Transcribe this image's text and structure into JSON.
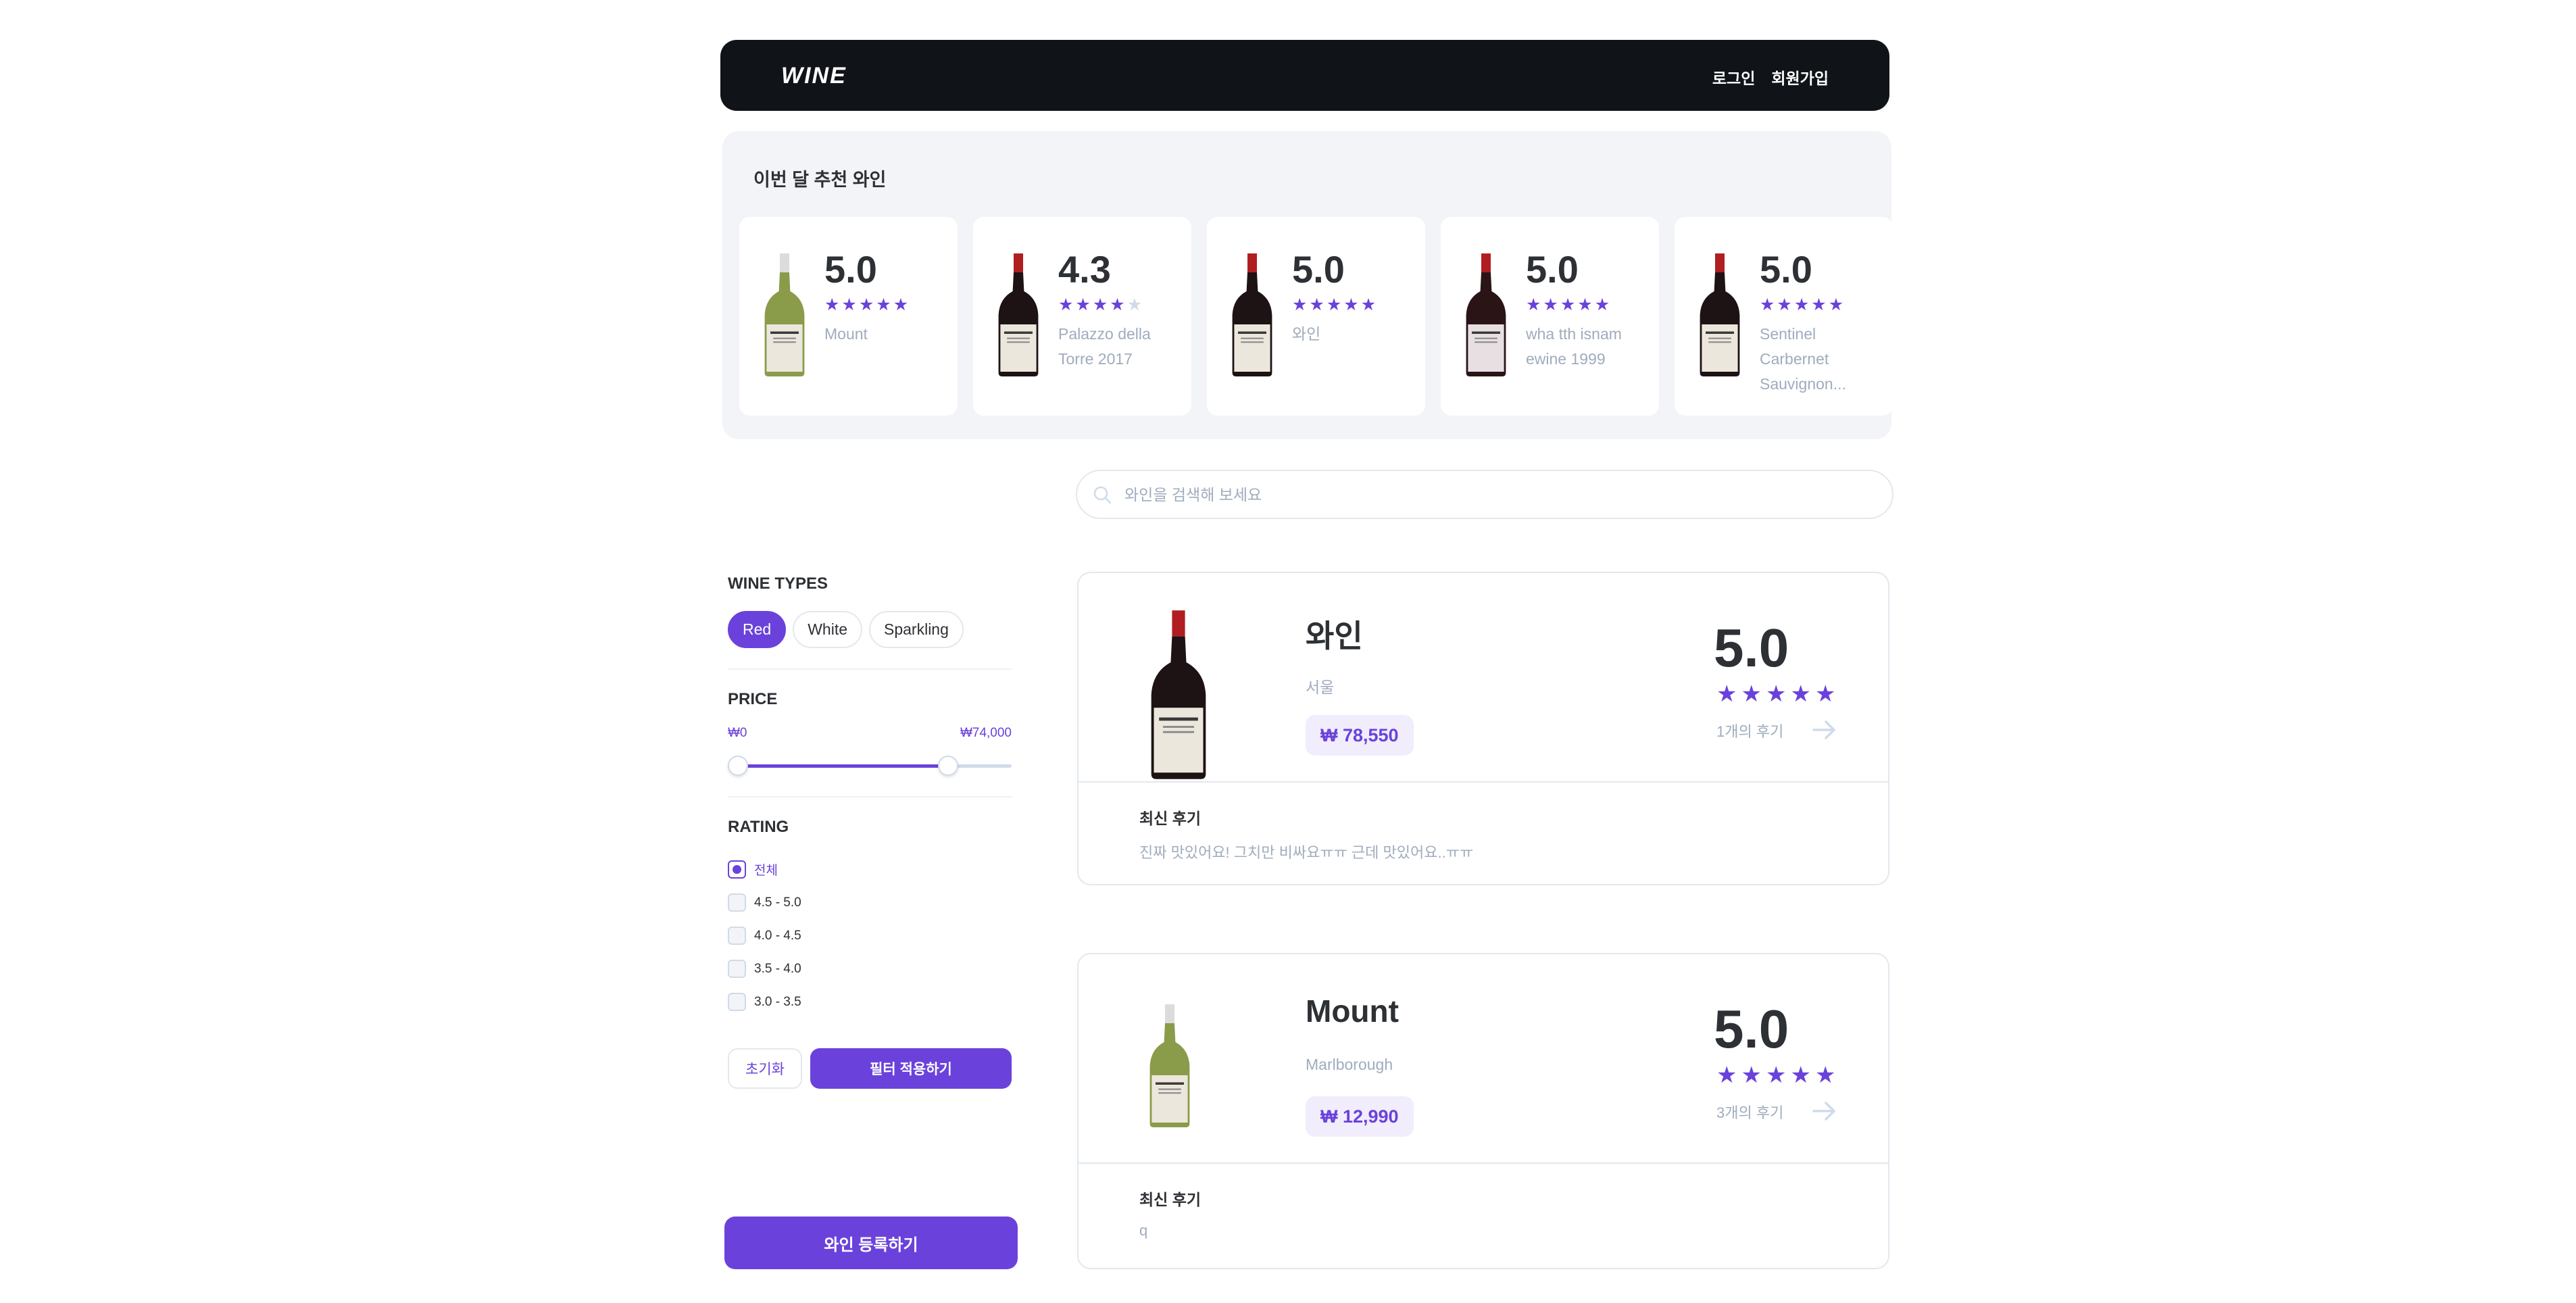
{
  "header": {
    "logo": "WINE",
    "login": "로그인",
    "signup": "회원가입"
  },
  "recommended": {
    "title": "이번 달 추천 와인",
    "items": [
      {
        "score": "5.0",
        "rating": 5,
        "name": "Mount",
        "bottle": "white"
      },
      {
        "score": "4.3",
        "rating": 4,
        "name": "Palazzo della Torre 2017",
        "bottle": "red-label"
      },
      {
        "score": "5.0",
        "rating": 5,
        "name": "와인",
        "bottle": "red-label"
      },
      {
        "score": "5.0",
        "rating": 5,
        "name": "wha tth isnam ewine 1999",
        "bottle": "dark"
      },
      {
        "score": "5.0",
        "rating": 5,
        "name": "Sentinel Carbernet Sauvignon...",
        "bottle": "red-label"
      }
    ]
  },
  "search": {
    "placeholder": "와인을 검색해 보세요",
    "icon": "search-icon"
  },
  "filter": {
    "types_title": "WINE TYPES",
    "types": [
      {
        "label": "Red",
        "active": true
      },
      {
        "label": "White",
        "active": false
      },
      {
        "label": "Sparkling",
        "active": false
      }
    ],
    "price_title": "PRICE",
    "price_min": "₩0",
    "price_max": "₩74,000",
    "price_low_fraction": 0.0,
    "price_high_fraction": 0.74,
    "rating_title": "RATING",
    "rating_options": [
      {
        "label": "전체",
        "checked": true
      },
      {
        "label": "4.5 - 5.0",
        "checked": false
      },
      {
        "label": "4.0 - 4.5",
        "checked": false
      },
      {
        "label": "3.5 - 4.0",
        "checked": false
      },
      {
        "label": "3.0 - 3.5",
        "checked": false
      }
    ],
    "reset_label": "초기화",
    "apply_label": "필터 적용하기"
  },
  "register_label": "와인 등록하기",
  "wines": [
    {
      "name": "와인",
      "region": "서울",
      "price": "₩ 78,550",
      "score": "5.0",
      "rating": 5,
      "reviews": "1개의 후기",
      "latest_title": "최신 후기",
      "latest_review": "진짜 맛있어요! 그치만 비싸요ㅠㅠ 근데 맛있어요..ㅠㅠ",
      "bottle": "red-label"
    },
    {
      "name": "Mount",
      "region": "Marlborough",
      "price": "₩ 12,990",
      "score": "5.0",
      "rating": 5,
      "reviews": "3개의 후기",
      "latest_title": "최신 후기",
      "latest_review": "q",
      "bottle": "white"
    }
  ],
  "colors": {
    "accent": "#6a42db",
    "header_bg": "#101318",
    "muted": "#9facbd",
    "border": "#e3e8ef"
  }
}
